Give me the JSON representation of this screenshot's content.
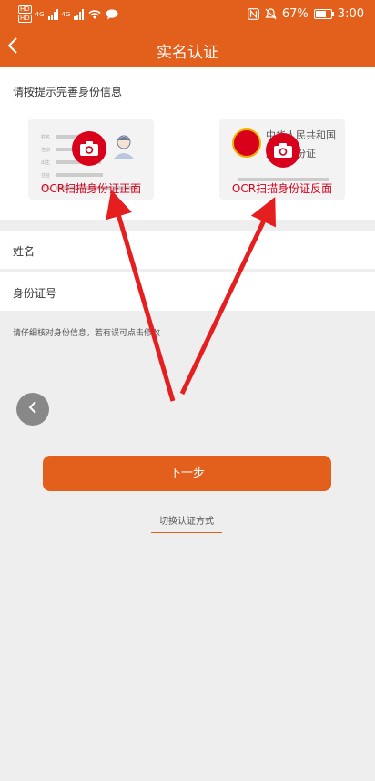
{
  "status_bar": {
    "hd1": "HD",
    "hd2": "HD",
    "net1": "4G",
    "net2": "4G",
    "battery_percent": "67%",
    "battery_level": 0.67,
    "time": "3:00"
  },
  "header": {
    "title": "实名认证",
    "back_icon": "chevron-left-icon"
  },
  "hint": "请按提示完善身份信息",
  "id_front": {
    "label": "OCR扫描身份证正面",
    "field_labels": [
      "姓名",
      "性别",
      "出生",
      "住址",
      "号码"
    ]
  },
  "id_back": {
    "label": "OCR扫描身份证反面",
    "title_line1": "中华人民共和国",
    "title_line2": "居民身份证"
  },
  "form": {
    "name_label": "姓名",
    "id_number_label": "身份证号"
  },
  "note": "请仔细核对身份信息，若有误可点击修改",
  "next_button": "下一步",
  "switch_link": "切换认证方式",
  "colors": {
    "brand": "#e2601c",
    "accent_red": "#d8001b",
    "background": "#eeeeee"
  }
}
